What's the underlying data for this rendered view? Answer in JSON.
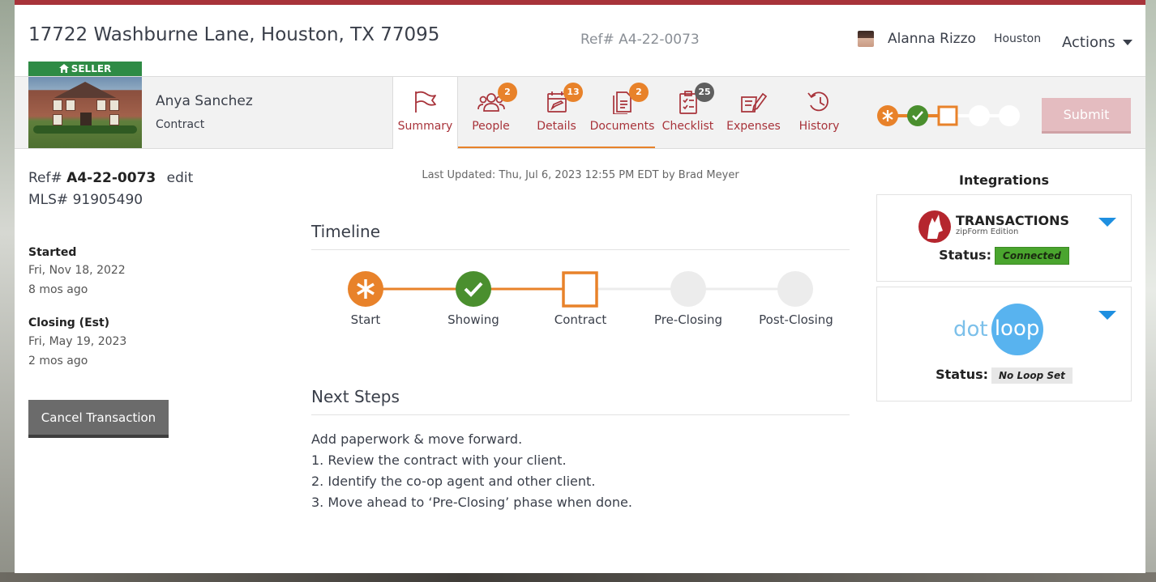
{
  "header": {
    "address": "17722 Washburne Lane, Houston, TX 77095",
    "ref_top": "Ref# A4-22-0073",
    "user_name": "Alanna Rizzo",
    "office": "Houston",
    "actions_label": "Actions"
  },
  "listing": {
    "badge": "SELLER",
    "client_name": "Anya Sanchez",
    "stage": "Contract"
  },
  "tabs": [
    {
      "label": "Summary",
      "badge": ""
    },
    {
      "label": "People",
      "badge": "2"
    },
    {
      "label": "Details",
      "badge": "13"
    },
    {
      "label": "Documents",
      "badge": "2"
    },
    {
      "label": "Checklist",
      "badge": "25"
    },
    {
      "label": "Expenses",
      "badge": ""
    },
    {
      "label": "History",
      "badge": ""
    }
  ],
  "submit_label": "Submit",
  "info": {
    "ref_prefix": "Ref#",
    "ref_value": "A4-22-0073",
    "edit_label": "edit",
    "mls": "MLS# 91905490",
    "started_label": "Started",
    "started_date": "Fri, Nov 18, 2022",
    "started_ago": "8 mos ago",
    "closing_label": "Closing (Est)",
    "closing_date": "Fri, May 19, 2023",
    "closing_ago": "2 mos ago",
    "cancel_label": "Cancel Transaction"
  },
  "last_updated": "Last Updated: Thu, Jul 6, 2023 12:55 PM EDT by Brad Meyer",
  "timeline": {
    "title": "Timeline",
    "stages": [
      "Start",
      "Showing",
      "Contract",
      "Pre-Closing",
      "Post-Closing"
    ]
  },
  "next_steps": {
    "title": "Next Steps",
    "lines": [
      "Add paperwork & move forward.",
      "1. Review the contract with your client.",
      "2. Identify the co-op agent and other client.",
      "3. Move ahead to ‘Pre-Closing’ phase when done."
    ]
  },
  "integrations": {
    "title": "Integrations",
    "transactions": {
      "logo_text": "TRANSACTIONS",
      "logo_sub": "zipForm Edition",
      "status_label": "Status:",
      "status_value": "Connected"
    },
    "dotloop": {
      "logo_dot": "dot",
      "logo_loop": "loop",
      "status_label": "Status:",
      "status_value": "No Loop Set"
    }
  },
  "colors": {
    "brand_red": "#a8333a",
    "orange": "#e8822a",
    "green": "#4a8f2e",
    "blue": "#1e8fe0"
  }
}
